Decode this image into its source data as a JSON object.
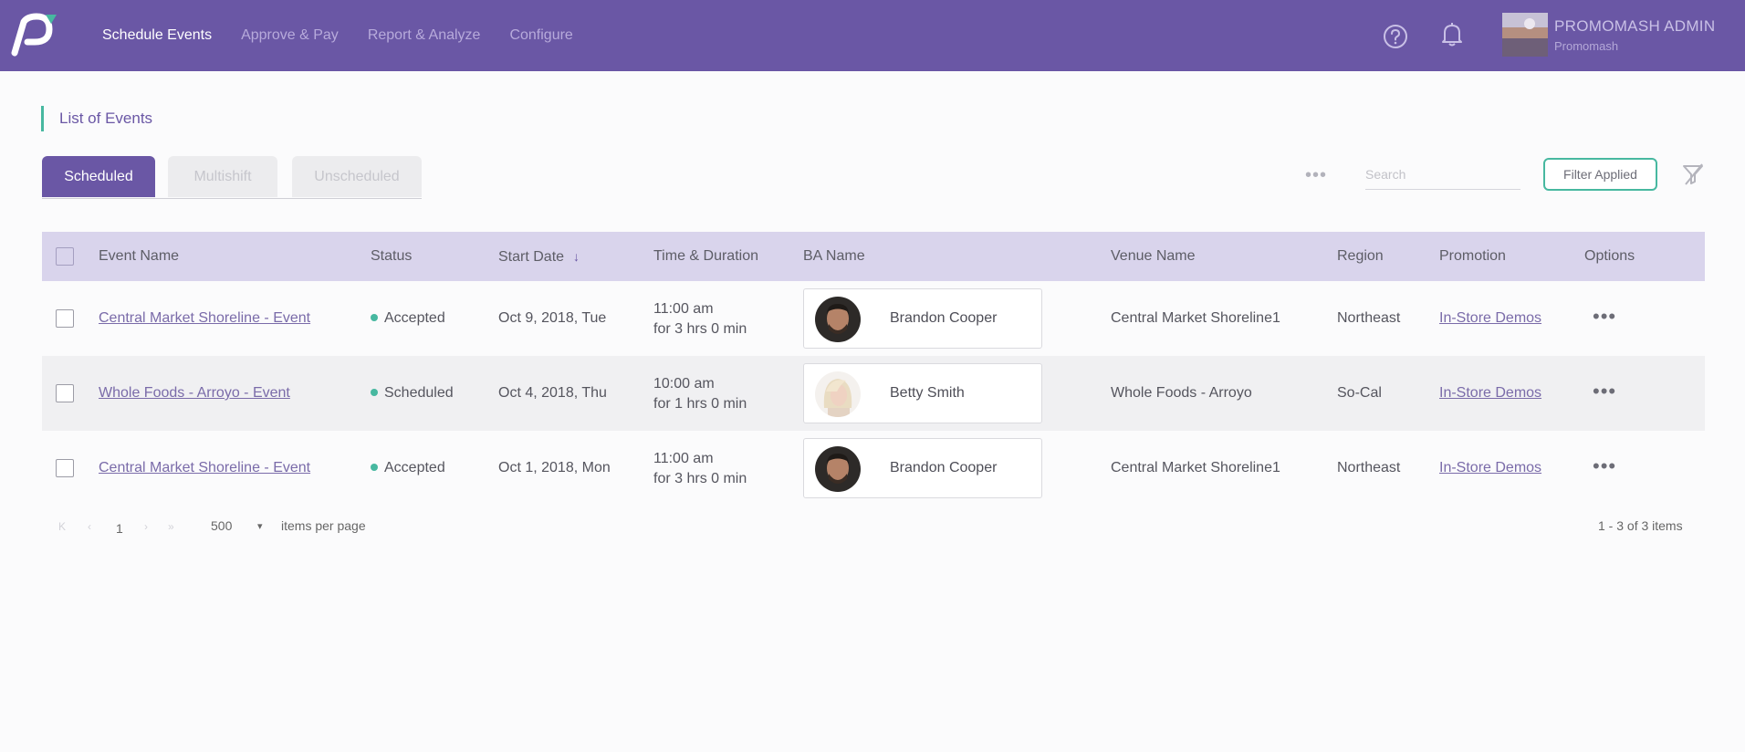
{
  "nav": {
    "items": [
      {
        "label": "Schedule Events",
        "active": true
      },
      {
        "label": "Approve & Pay",
        "active": false
      },
      {
        "label": "Report & Analyze",
        "active": false
      },
      {
        "label": "Configure",
        "active": false
      }
    ],
    "user": {
      "name": "PROMOMASH ADMIN",
      "org": "Promomash"
    }
  },
  "page": {
    "title": "List of Events"
  },
  "tabs": [
    {
      "label": "Scheduled",
      "active": true
    },
    {
      "label": "Multishift",
      "active": false
    },
    {
      "label": "Unscheduled",
      "active": false
    }
  ],
  "toolbar": {
    "more": "•••",
    "search_placeholder": "Search",
    "filter_label": "Filter Applied"
  },
  "table": {
    "headers": {
      "event_name": "Event Name",
      "status": "Status",
      "start_date": "Start Date",
      "time_duration": "Time & Duration",
      "ba_name": "BA Name",
      "venue_name": "Venue Name",
      "region": "Region",
      "promotion": "Promotion",
      "options": "Options"
    },
    "sort_indicator": "↓",
    "rows": [
      {
        "event": "Central Market Shoreline - Event",
        "status": "Accepted",
        "date": "Oct 9, 2018, Tue",
        "time": "11:00 am",
        "duration": "for 3 hrs 0 min",
        "ba": "Brandon Cooper",
        "venue": "Central Market Shoreline1",
        "region": "Northeast",
        "promotion": "In-Store Demos",
        "options": "•••"
      },
      {
        "event": "Whole Foods - Arroyo - Event",
        "status": "Scheduled",
        "date": "Oct 4, 2018, Thu",
        "time": "10:00 am",
        "duration": "for 1 hrs 0 min",
        "ba": "Betty Smith",
        "venue": "Whole Foods - Arroyo",
        "region": "So-Cal",
        "promotion": "In-Store Demos",
        "options": "•••"
      },
      {
        "event": "Central Market Shoreline - Event",
        "status": "Accepted",
        "date": "Oct 1, 2018, Mon",
        "time": "11:00 am",
        "duration": "for 3 hrs 0 min",
        "ba": "Brandon Cooper",
        "venue": "Central Market Shoreline1",
        "region": "Northeast",
        "promotion": "In-Store Demos",
        "options": "•••"
      }
    ]
  },
  "pager": {
    "first": "K",
    "prev": "‹",
    "page": "1",
    "next": "›",
    "last": "»",
    "page_size": "500",
    "dropdown": "▾",
    "per_page_label": "items per page",
    "range": "1 - 3 of 3 items"
  },
  "colors": {
    "brand": "#6a57a5",
    "accent": "#47b8a0",
    "header_bg": "#d9d4ec"
  }
}
